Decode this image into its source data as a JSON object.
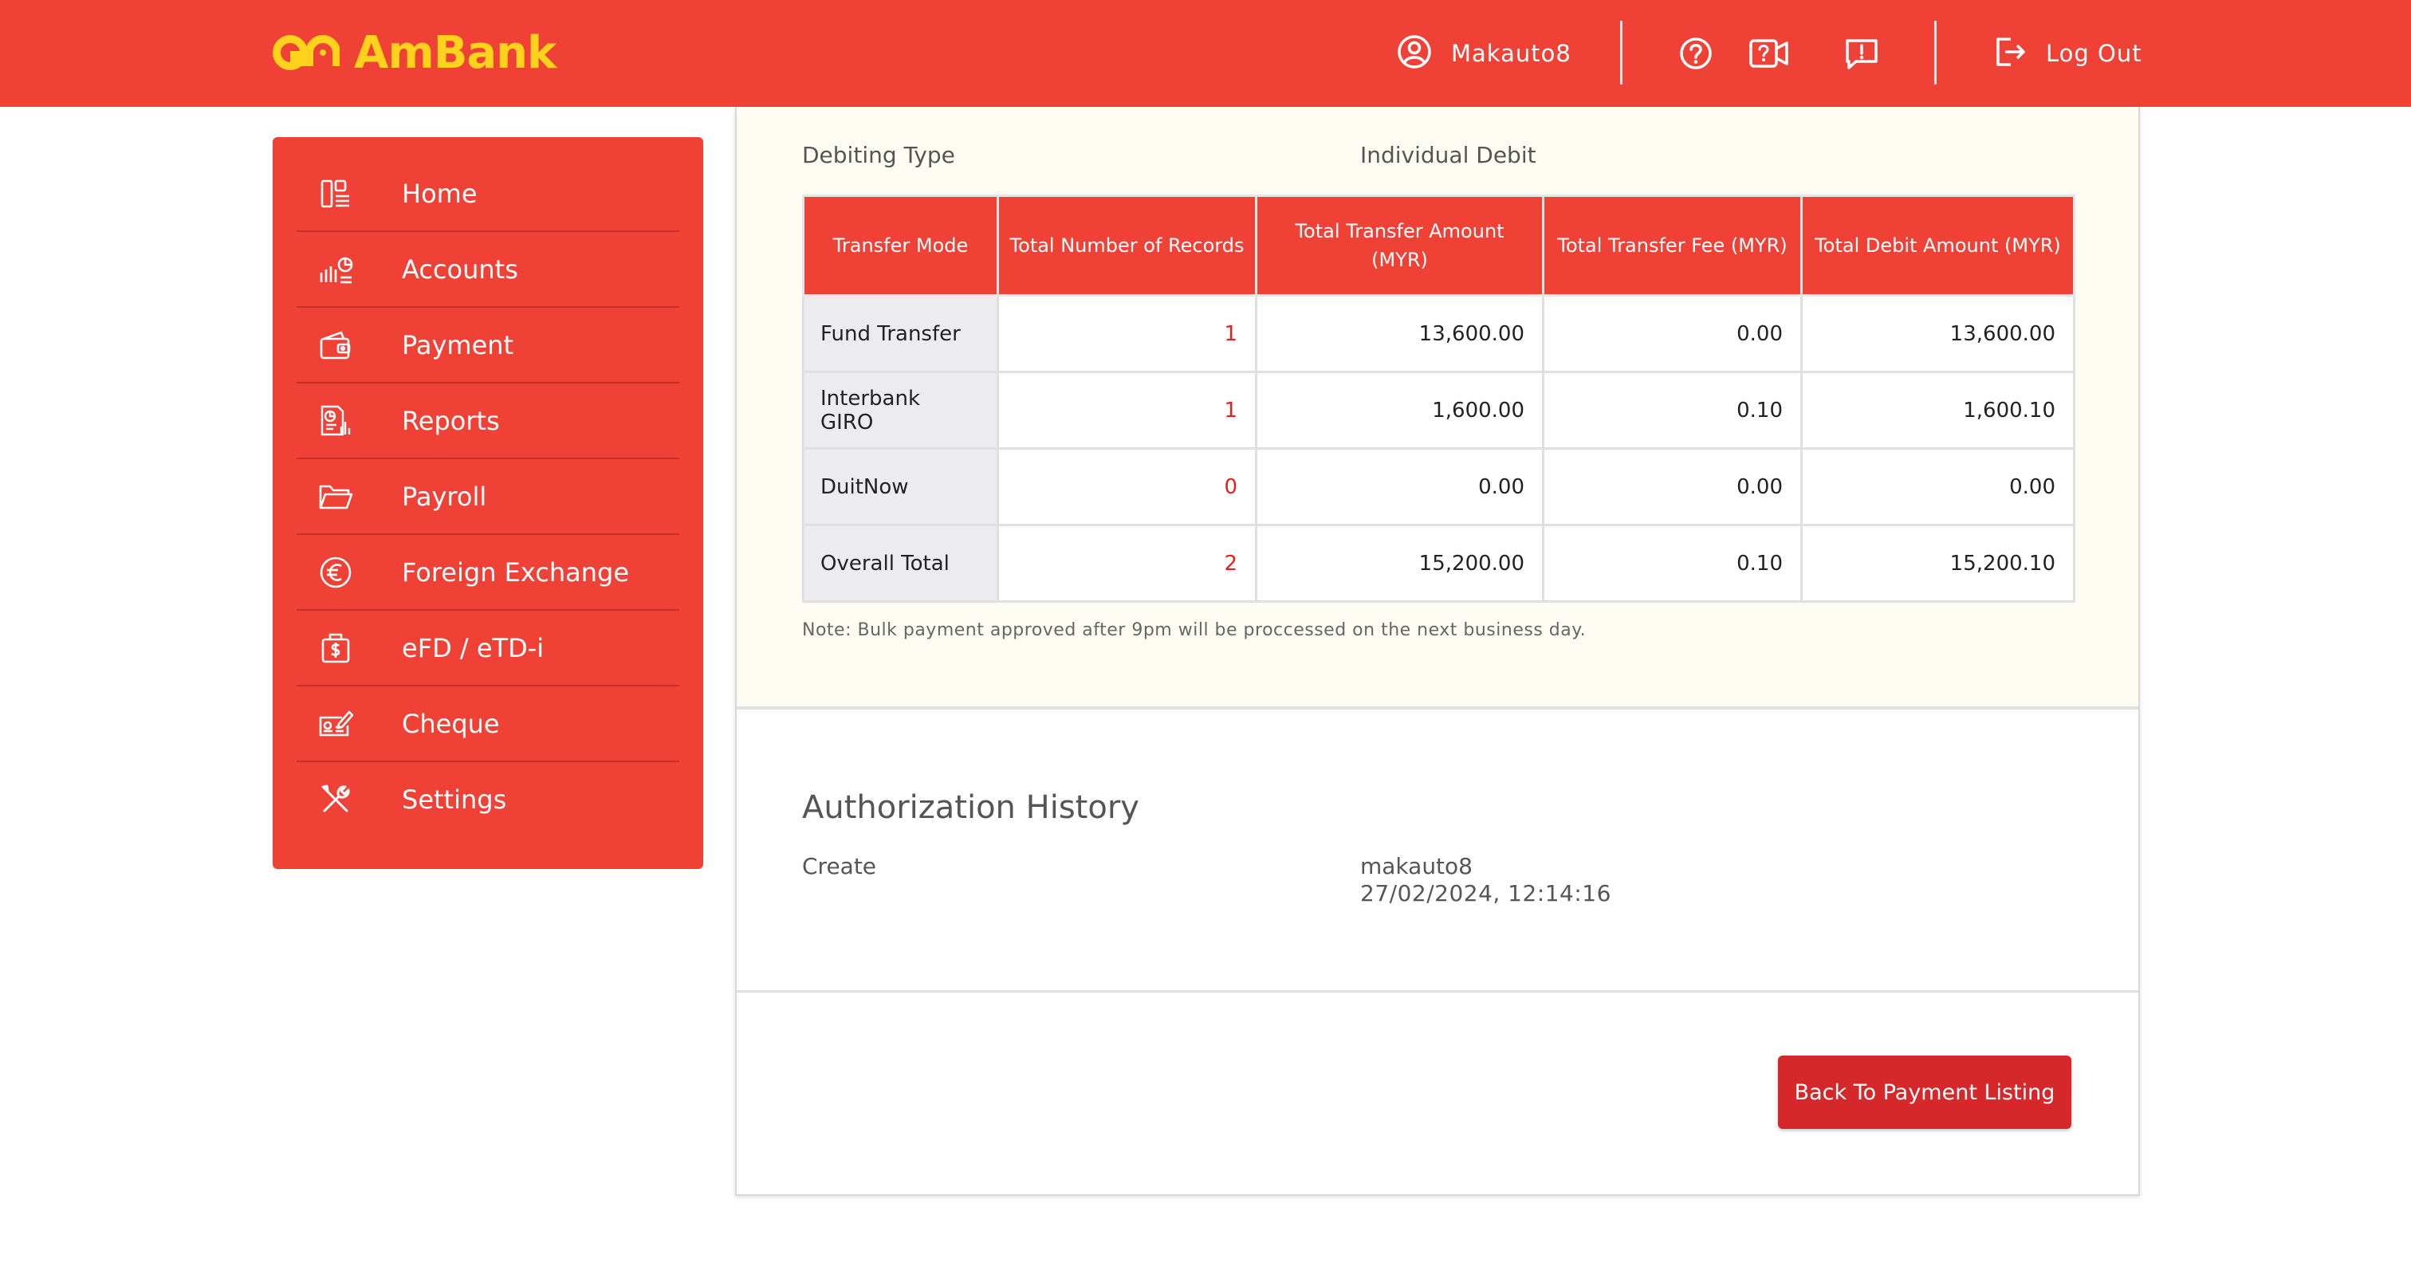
{
  "header": {
    "logo_text": "AmBank",
    "username": "Makauto8",
    "logout_label": "Log Out",
    "brand_color": "#ef4136",
    "logo_color": "#ffd21c"
  },
  "sidebar": {
    "items": [
      {
        "label": "Home",
        "icon": "dashboard-icon"
      },
      {
        "label": "Accounts",
        "icon": "accounts-chart-icon"
      },
      {
        "label": "Payment",
        "icon": "wallet-icon"
      },
      {
        "label": "Reports",
        "icon": "report-icon"
      },
      {
        "label": "Payroll",
        "icon": "folder-icon"
      },
      {
        "label": "Foreign Exchange",
        "icon": "euro-icon"
      },
      {
        "label": "eFD / eTD-i",
        "icon": "money-bag-icon"
      },
      {
        "label": "Cheque",
        "icon": "cheque-icon"
      },
      {
        "label": "Settings",
        "icon": "tools-icon"
      }
    ]
  },
  "summary": {
    "debiting_type_label": "Debiting Type",
    "debiting_type_value": "Individual Debit",
    "columns": [
      "Transfer Mode",
      "Total Number of Records",
      "Total Transfer Amount (MYR)",
      "Total Transfer Fee (MYR)",
      "Total Debit Amount (MYR)"
    ],
    "rows": [
      {
        "mode": "Fund Transfer",
        "records": "1",
        "amount": "13,600.00",
        "fee": "0.00",
        "debit": "13,600.00"
      },
      {
        "mode": "Interbank GIRO",
        "records": "1",
        "amount": "1,600.00",
        "fee": "0.10",
        "debit": "1,600.10"
      },
      {
        "mode": "DuitNow",
        "records": "0",
        "amount": "0.00",
        "fee": "0.00",
        "debit": "0.00"
      },
      {
        "mode": "Overall Total",
        "records": "2",
        "amount": "15,200.00",
        "fee": "0.10",
        "debit": "15,200.10"
      }
    ],
    "note": "Note: Bulk payment approved after 9pm will be proccessed on the next business day."
  },
  "authorization_history": {
    "title": "Authorization History",
    "action": "Create",
    "user": "makauto8",
    "timestamp": "27/02/2024, 12:14:16"
  },
  "footer": {
    "back_button_label": "Back To Payment Listing"
  }
}
